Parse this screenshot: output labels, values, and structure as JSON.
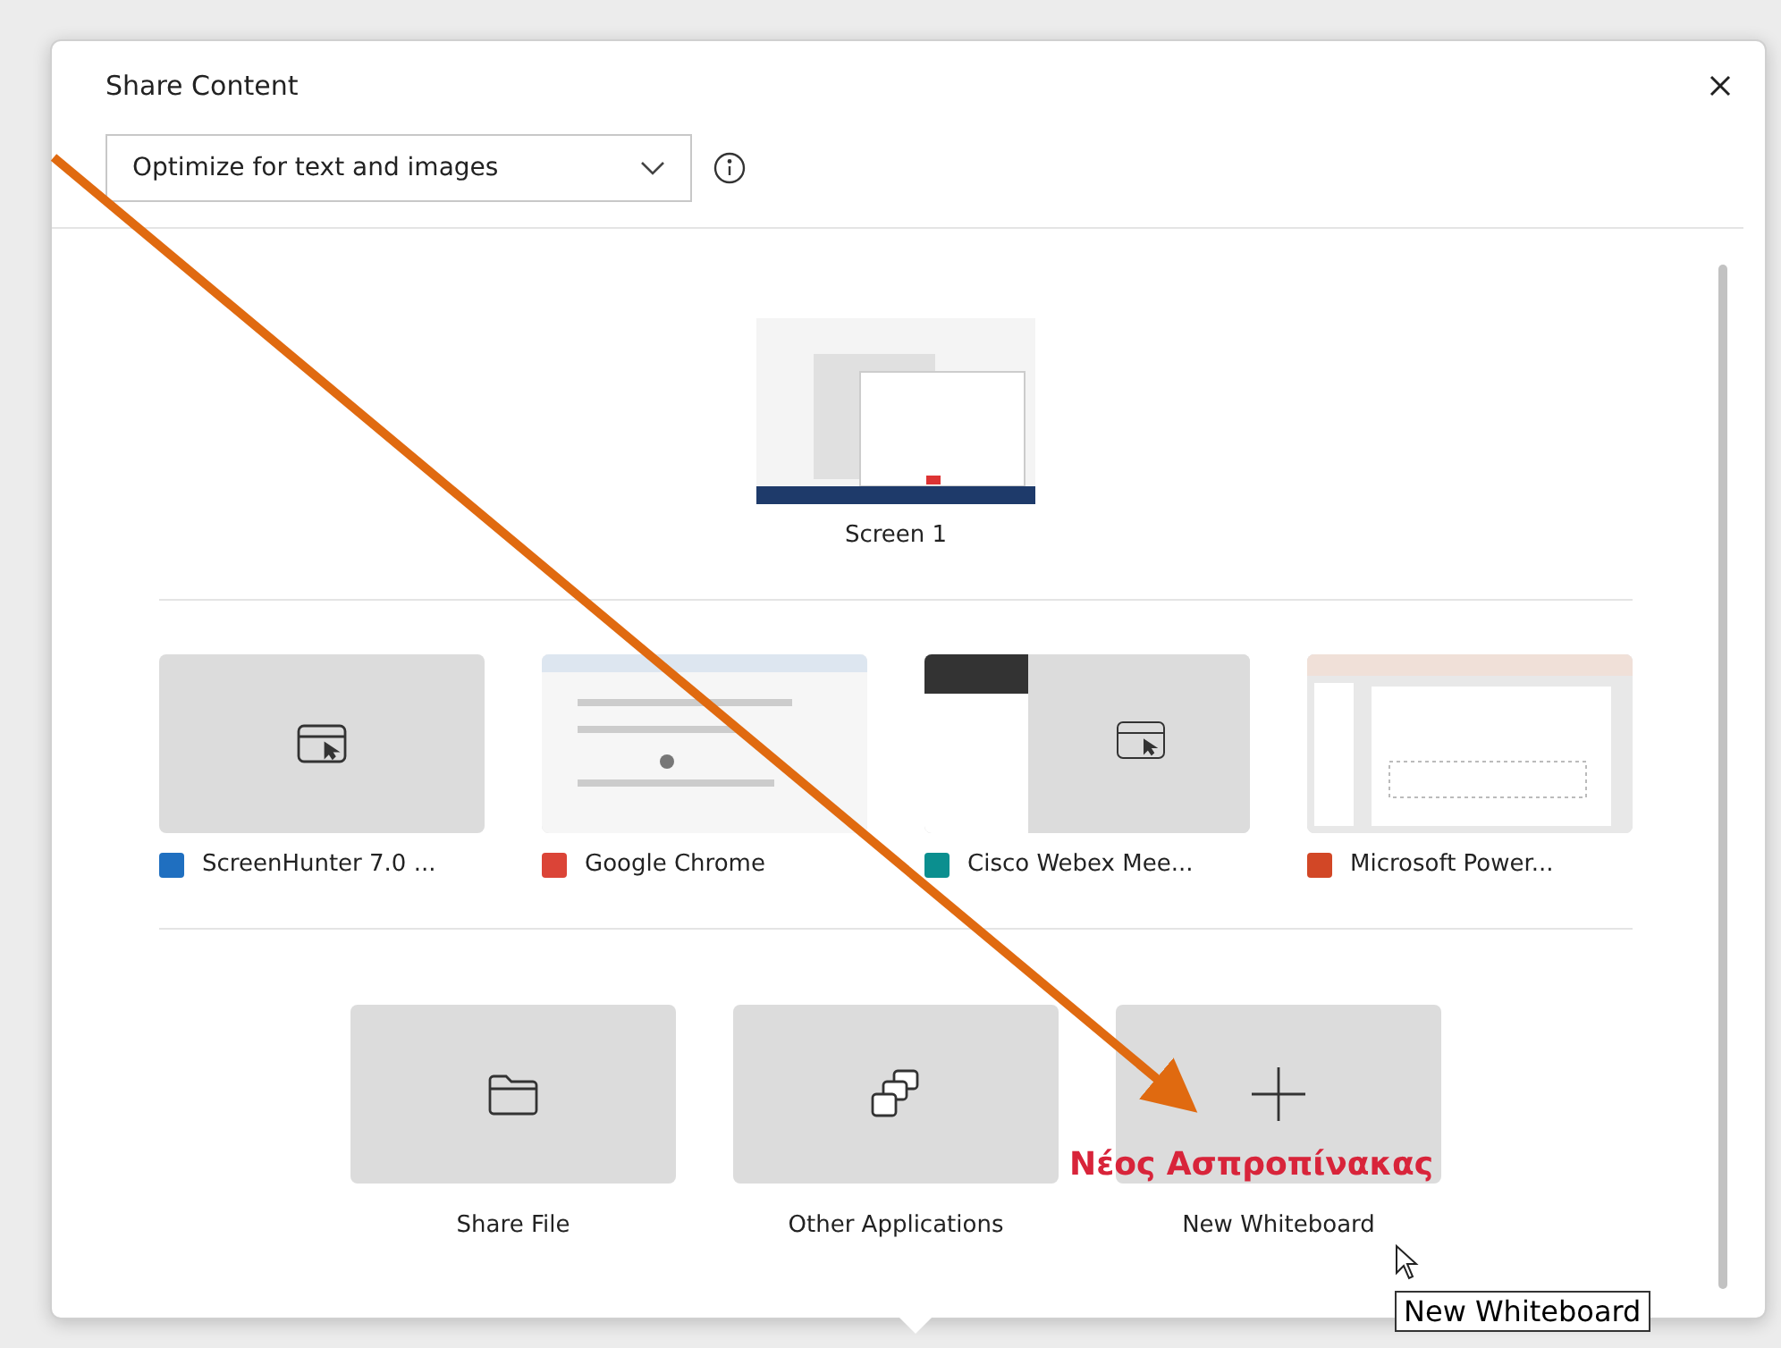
{
  "dialog": {
    "title": "Share Content",
    "optimize": {
      "value": "Optimize for text and images"
    }
  },
  "screens": [
    {
      "label": "Screen 1"
    }
  ],
  "applications": [
    {
      "label": "ScreenHunter 7.0 ...",
      "kind": "placeholder",
      "color": "#1f6fc0"
    },
    {
      "label": "Google Chrome",
      "kind": "browser",
      "color": "#db4437"
    },
    {
      "label": "Cisco Webex Mee...",
      "kind": "meeting",
      "color": "#0b8f8f"
    },
    {
      "label": "Microsoft Power...",
      "kind": "slides",
      "color": "#d24726"
    }
  ],
  "options": [
    {
      "label": "Share File",
      "kind": "folder"
    },
    {
      "label": "Other Applications",
      "kind": "apps"
    },
    {
      "label": "New Whiteboard",
      "kind": "plus"
    }
  ],
  "annotation": {
    "text": "Νέος Ασπροπίνακας"
  },
  "tooltip": {
    "text": "New Whiteboard"
  }
}
